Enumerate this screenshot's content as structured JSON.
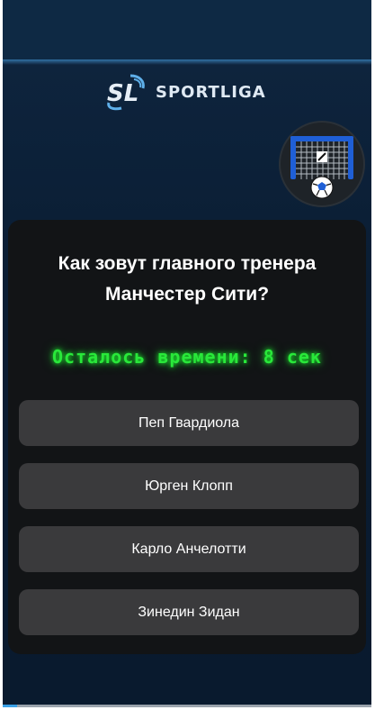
{
  "brand": {
    "mark": "SL",
    "name": "SPORTLIGA"
  },
  "header": {
    "goal_icon": "soccer-goal-icon"
  },
  "quiz": {
    "question": "Как зовут главного тренера\nМанчестер Сити?",
    "timer_text": "Осталось времени: 8 сек",
    "answers": [
      "Пеп Гвардиола",
      "Юрген Клопп",
      "Карло Анчелотти",
      "Зинедин Зидан"
    ]
  },
  "colors": {
    "background": "#0a1d33",
    "card": "#121416",
    "answer": "#3a3a3c",
    "timer": "#29e83a",
    "accent": "#3aa0e6"
  }
}
